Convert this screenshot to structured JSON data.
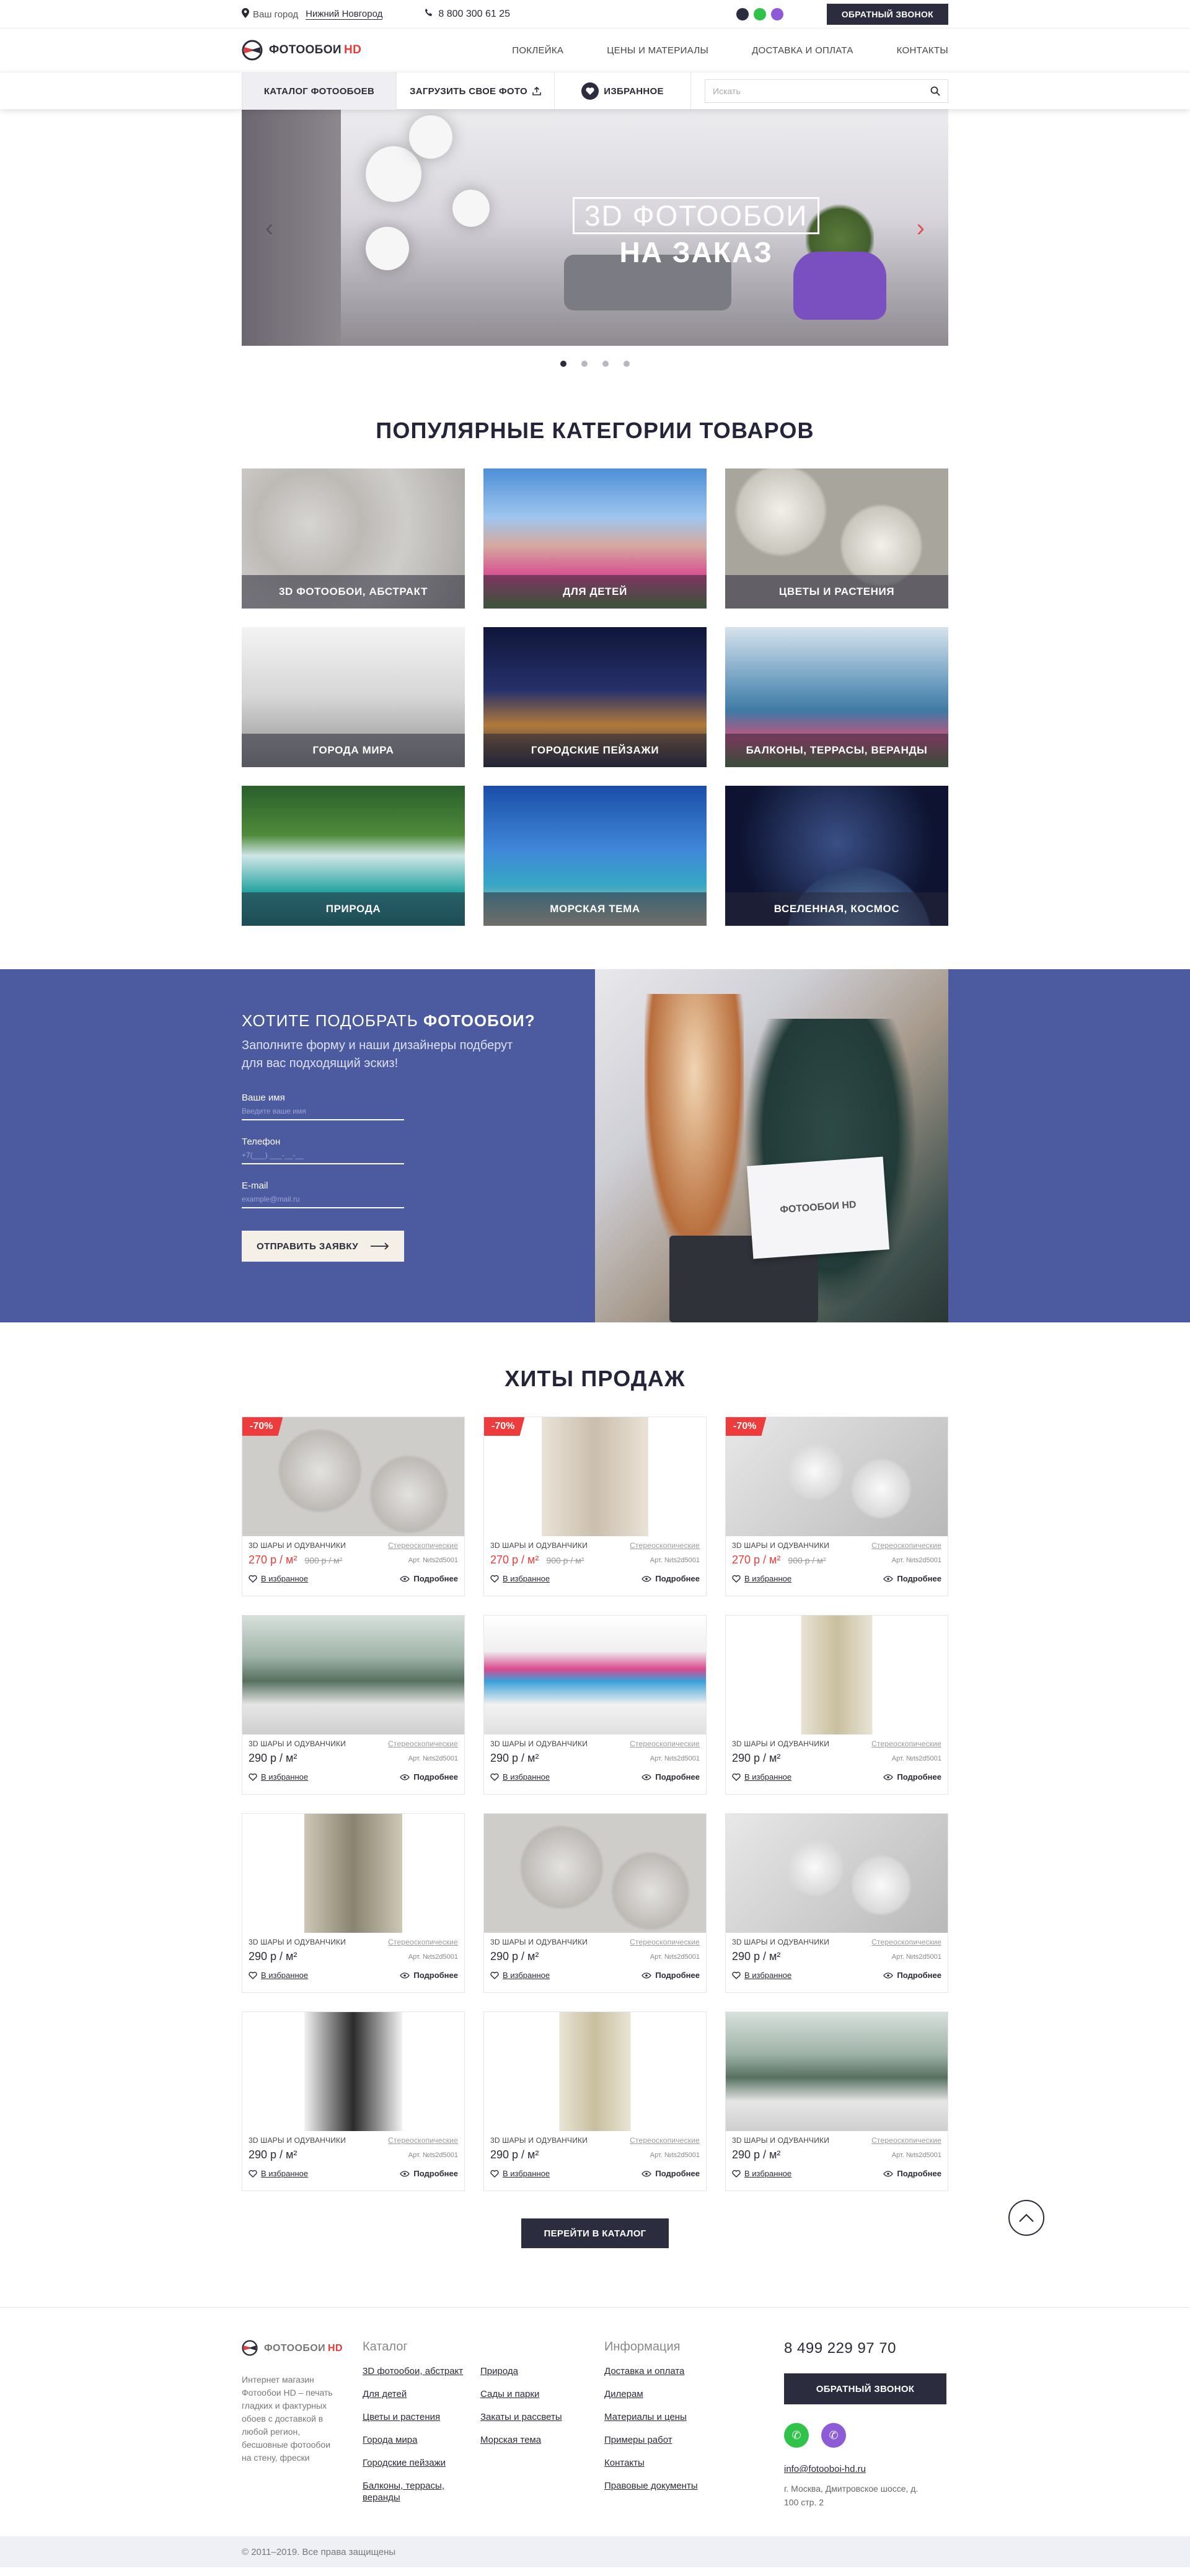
{
  "topbar": {
    "city_label": "Ваш город",
    "city": "Нижний Новгород",
    "phone": "8 800 300 61 25",
    "callback": "ОБРАТНЫЙ ЗВОНОК"
  },
  "header": {
    "logo_main": "ФОТООБОИ",
    "logo_hd": "HD",
    "nav": [
      "ПОКЛЕЙКА",
      "ЦЕНЫ И МАТЕРИАЛЫ",
      "ДОСТАВКА И ОПЛАТА",
      "КОНТАКТЫ"
    ]
  },
  "catbar": {
    "catalog": "КАТАЛОГ ФОТООБОЕВ",
    "upload": "ЗАГРУЗИТЬ СВОЕ ФОТО",
    "favorites": "ИЗБРАННОЕ",
    "search_placeholder": "Искать"
  },
  "hero": {
    "line1": "3D ФОТООБОИ",
    "line2": "НА ЗАКАЗ",
    "prev": "‹",
    "next": "›",
    "slides": 4,
    "active_slide": 1
  },
  "categories": {
    "title": "ПОПУЛЯРНЫЕ КАТЕГОРИИ ТОВАРОВ",
    "items": [
      {
        "label": "3D ФОТООБОИ, АБСТРАКТ"
      },
      {
        "label": "ДЛЯ ДЕТЕЙ"
      },
      {
        "label": "ЦВЕТЫ И РАСТЕНИЯ"
      },
      {
        "label": "ГОРОДА МИРА"
      },
      {
        "label": "ГОРОДСКИЕ ПЕЙЗАЖИ"
      },
      {
        "label": "БАЛКОНЫ, ТЕРРАСЫ, ВЕРАНДЫ"
      },
      {
        "label": "ПРИРОДА"
      },
      {
        "label": "МОРСКАЯ ТЕМА"
      },
      {
        "label": "ВСЕЛЕННАЯ, КОСМОС"
      }
    ]
  },
  "promo": {
    "title_a": "ХОТИТЕ ПОДОБРАТЬ ",
    "title_b": "ФОТООБОИ?",
    "subtitle": "Заполните форму и наши дизайнеры подберут для вас подходящий эскиз!",
    "name_label": "Ваше имя",
    "name_placeholder": "Введите ваше имя",
    "phone_label": "Телефон",
    "phone_placeholder": "+7(___) ___-__-__",
    "email_label": "E-mail",
    "email_placeholder": "example@mail.ru",
    "submit": "ОТПРАВИТЬ ЗАЯВКУ",
    "folder_text": "ФОТООБОИ HD"
  },
  "hits": {
    "title": "ХИТЫ ПРОДАЖ",
    "category": "3D ШАРЫ И ОДУВАНЧИКИ",
    "material": "Стереоскопические",
    "article": "Арт. №ts2d5001",
    "fav": "В избранное",
    "more": "Подробнее",
    "products": [
      {
        "price": "270 р / м²",
        "old": "900 р / м²",
        "discount": "-70%"
      },
      {
        "price": "270 р / м²",
        "old": "900 р / м²",
        "discount": "-70%"
      },
      {
        "price": "270 р / м²",
        "old": "900 р / м²",
        "discount": "-70%"
      },
      {
        "price": "290 р / м²"
      },
      {
        "price": "290 р / м²"
      },
      {
        "price": "290 р / м²"
      },
      {
        "price": "290 р / м²"
      },
      {
        "price": "290 р / м²"
      },
      {
        "price": "290 р / м²"
      },
      {
        "price": "290 р / м²"
      },
      {
        "price": "290 р / м²"
      },
      {
        "price": "290 р / м²"
      }
    ],
    "to_catalog": "ПЕРЕЙТИ В КАТАЛОГ"
  },
  "footer": {
    "about": "Интернет магазин Фотообои HD – печать гладких и фактурных обоев с доставкой в любой регион, бесшовные фотообои на стену, фрески",
    "catalog_title": "Каталог",
    "catalog_a": [
      "3D фотообои, абстракт",
      "Для детей",
      "Цветы и растения",
      "Города мира",
      "Городские пейзажи",
      "Балконы, террасы, веранды"
    ],
    "catalog_b": [
      "Природа",
      "Сады и парки",
      "Закаты и рассветы",
      "Морская тема"
    ],
    "info_title": "Информация",
    "info": [
      "Доставка и оплата",
      "Дилерам",
      "Материалы и цены",
      "Примеры работ",
      "Контакты",
      "Правовые документы"
    ],
    "phone": "8 499 229 97 70",
    "callback": "ОБРАТНЫЙ ЗВОНОК",
    "email": "info@fotooboi-hd.ru",
    "address": "г. Москва, Дмитровское шоссе, д. 100 стр. 2",
    "copyright": "© 2011–2019. Все права защищены"
  },
  "colors": {
    "accent_red": "#ee3b3b",
    "dark": "#2c2c3f",
    "promo_bg": "#4c5aa0",
    "whatsapp": "#31c24a",
    "viber": "#8d5bd8"
  }
}
